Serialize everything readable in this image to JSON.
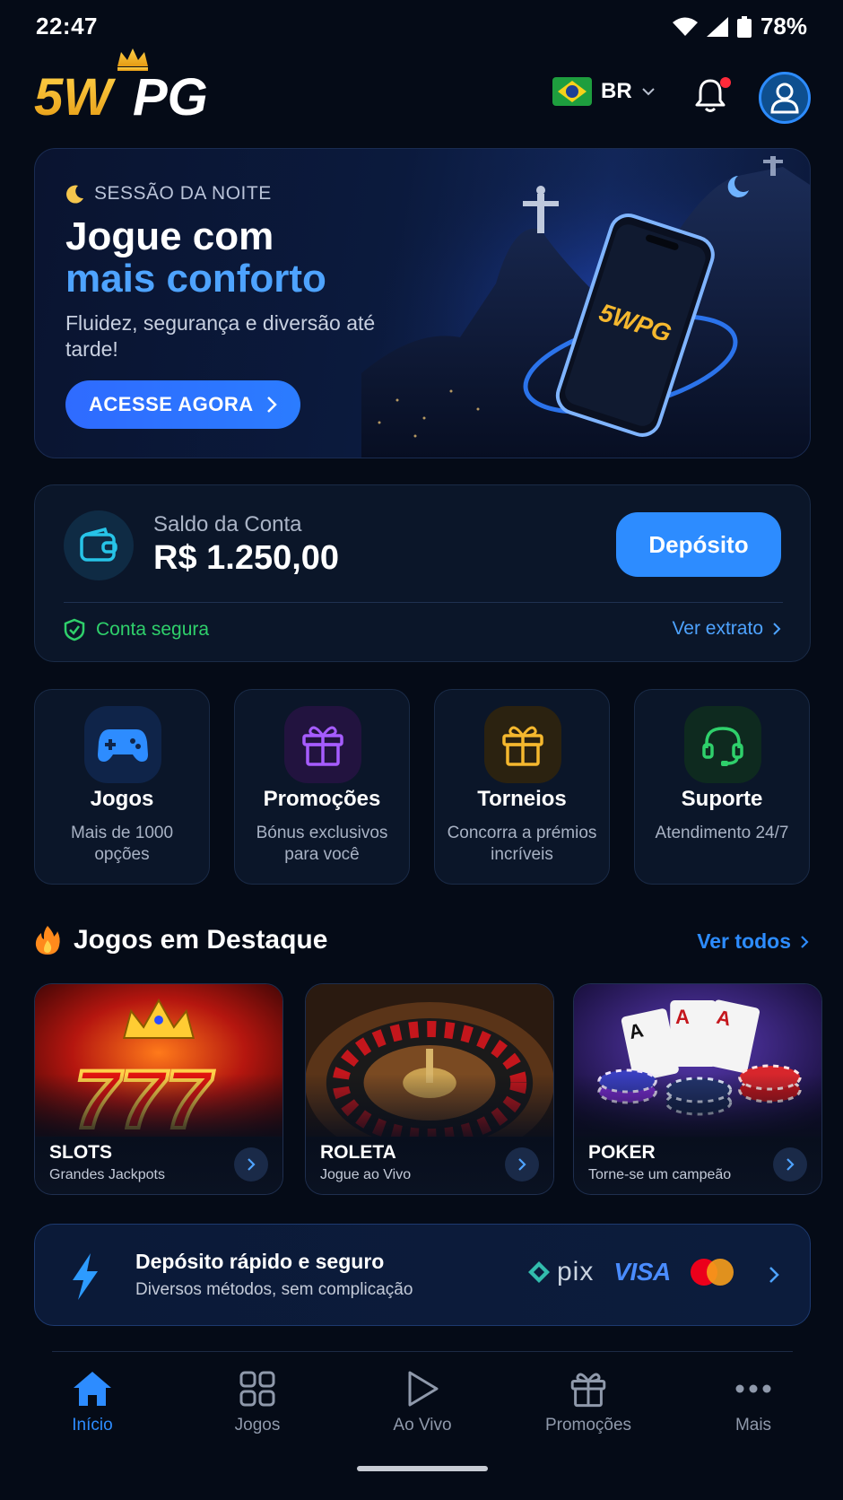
{
  "status_bar": {
    "time": "22:47",
    "battery": "78%"
  },
  "header": {
    "logo_text": "5WPG",
    "language_code": "BR",
    "notification_badge_color": "#ff2a3a"
  },
  "hero": {
    "kicker": "SESSÃO DA NOITE",
    "title_line1": "Jogue com",
    "title_line2": "mais conforto",
    "subtitle": "Fluidez, segurança e diversão até tarde!",
    "cta_label": "ACESSE AGORA",
    "phone_logo": "5WPG"
  },
  "balance": {
    "label": "Saldo da Conta",
    "value": "R$ 1.250,00",
    "deposit_label": "Depósito",
    "secure_label": "Conta segura",
    "statement_label": "Ver extrato"
  },
  "quick_links": [
    {
      "title": "Jogos",
      "subtitle": "Mais de 1000 opções",
      "icon": "gamepad-icon"
    },
    {
      "title": "Promoções",
      "subtitle": "Bónus exclusivos para você",
      "icon": "gift-icon"
    },
    {
      "title": "Torneios",
      "subtitle": "Concorra a prémios incríveis",
      "icon": "gift-icon"
    },
    {
      "title": "Suporte",
      "subtitle": "Atendimento 24/7",
      "icon": "headset-icon"
    }
  ],
  "featured": {
    "title": "Jogos em Destaque",
    "see_all_label": "Ver todos",
    "games": [
      {
        "title": "SLOTS",
        "subtitle": "Grandes Jackpots"
      },
      {
        "title": "ROLETA",
        "subtitle": "Jogue ao Vivo"
      },
      {
        "title": "POKER",
        "subtitle": "Torne-se um campeão"
      }
    ]
  },
  "payment_banner": {
    "title": "Depósito rápido e seguro",
    "subtitle": "Diversos métodos, sem complicação",
    "methods": [
      "pix",
      "VISA",
      "mastercard"
    ]
  },
  "bottom_nav": [
    {
      "label": "Início",
      "icon": "home-icon",
      "active": true
    },
    {
      "label": "Jogos",
      "icon": "grid-icon",
      "active": false
    },
    {
      "label": "Ao Vivo",
      "icon": "play-icon",
      "active": false
    },
    {
      "label": "Promoções",
      "icon": "gift-icon",
      "active": false
    },
    {
      "label": "Mais",
      "icon": "more-icon",
      "active": false
    }
  ],
  "colors": {
    "background": "#050b17",
    "accent": "#2d8cff",
    "success": "#2fd06b",
    "logo_gold": "#f5b82e"
  }
}
